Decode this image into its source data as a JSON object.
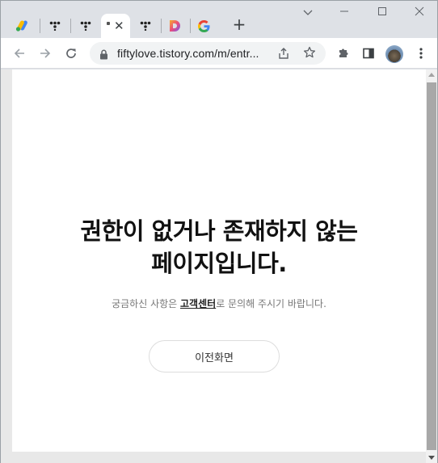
{
  "browser": {
    "tabs": [
      {
        "name": "google-ads-tab",
        "icon": "google-ads-icon",
        "active": false
      },
      {
        "name": "tistory-tab-1",
        "icon": "tistory-icon",
        "active": false
      },
      {
        "name": "tistory-tab-2",
        "icon": "tistory-icon",
        "active": false
      },
      {
        "name": "current-tab",
        "icon": "tistory-icon",
        "active": true
      },
      {
        "name": "tistory-tab-3",
        "icon": "tistory-icon",
        "active": false
      },
      {
        "name": "daum-tab",
        "icon": "daum-d-icon",
        "active": false
      },
      {
        "name": "google-tab",
        "icon": "google-icon",
        "active": false
      }
    ],
    "new_tab_label": "+",
    "close_label": "✕",
    "url": "fiftylove.tistory.com/m/entr..."
  },
  "page": {
    "headline_line1": "권한이 없거나 존재하지 않는",
    "headline_line2": "페이지입니다.",
    "sub_before": "궁금하신 사항은 ",
    "sub_link": "고객센터",
    "sub_after": "로 문의해 주시기 바랍니다.",
    "back_button": "이전화면"
  },
  "colors": {
    "tabstrip": "#dee1e6",
    "omnibox": "#f1f3f4",
    "scroll_thumb": "#a8a8a8"
  }
}
